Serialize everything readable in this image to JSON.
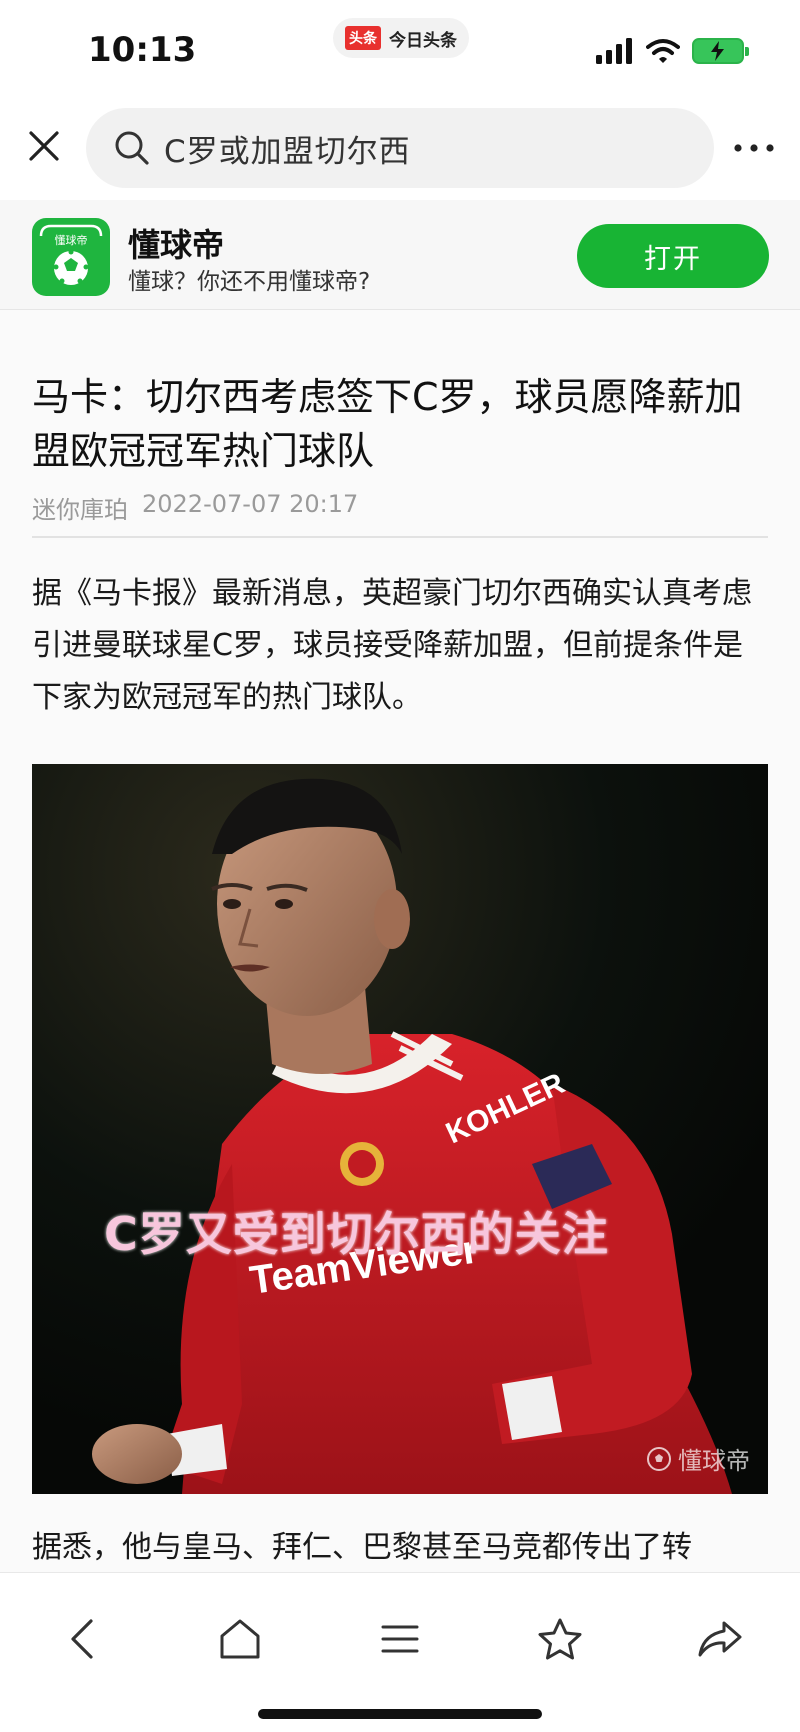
{
  "status_bar": {
    "time": "10:13",
    "app_logo": "头条",
    "app_name": "今日头条",
    "icons": [
      "signal-icon",
      "wifi-icon",
      "battery-charging-icon"
    ]
  },
  "search": {
    "query": "C罗或加盟切尔西",
    "icons": [
      "close-icon",
      "search-icon",
      "more-icon"
    ]
  },
  "app_banner": {
    "name": "懂球帝",
    "icon_text": "懂球帝",
    "subtitle": "懂球？你还不用懂球帝?",
    "open_label": "打开",
    "accent_color": "#18b434"
  },
  "article": {
    "title": "马卡：切尔西考虑签下C罗，球员愿降薪加盟欧冠冠军热门球队",
    "author": "迷你庫珀",
    "date": "2022-07-07 20:17",
    "paragraph1": "据《马卡报》最新消息，英超豪门切尔西确实认真考虑引进曼联球星C罗，球员接受降薪加盟，但前提条件是下家为欧冠冠军的热门球队。",
    "image_caption": "C罗又受到切尔西的关注",
    "image_watermark": "懂球帝",
    "shirt_sponsor": "TeamViewer",
    "sleeve_sponsor": "KOHLER",
    "paragraph2": "据悉，他与皇马、拜仁、巴黎甚至马竞都传出了转"
  },
  "bottom_nav": {
    "icons": [
      "back-icon",
      "home-icon",
      "menu-icon",
      "star-icon",
      "share-icon"
    ]
  }
}
